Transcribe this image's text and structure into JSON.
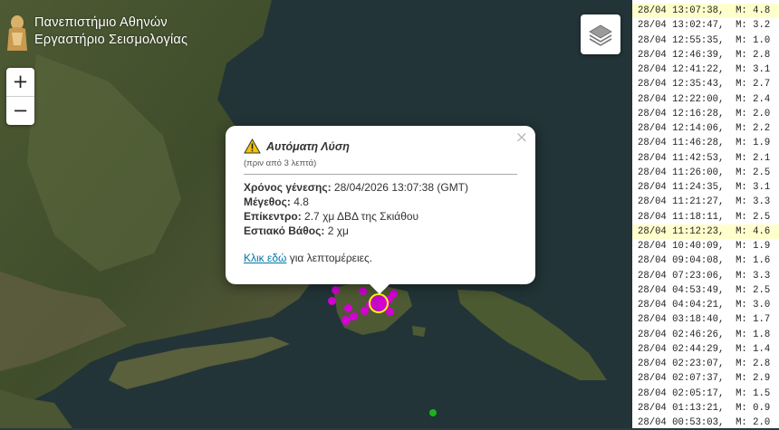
{
  "logo": {
    "line1": "Πανεπιστήμιο Αθηνών",
    "line2": "Εργαστήριο Σεισμολογίας"
  },
  "zoom": {
    "in": "+",
    "out": "−"
  },
  "layers_icon": "layers-icon",
  "popup": {
    "title": "Αυτόματη Λύση",
    "subtitle": "(πριν από 3 λεπτά)",
    "origin_label": "Χρόνος γένεσης:",
    "origin_value": "28/04/2026 13:07:38 (GMT)",
    "magnitude_label": "Μέγεθος:",
    "magnitude_value": "4.8",
    "epicenter_label": "Επίκεντρο:",
    "epicenter_value": "2.7 χμ ΔΒΔ της Σκιάθου",
    "depth_label": "Εστιακό Βάθος:",
    "depth_value": "2 χμ",
    "link_text": "Κλικ εδώ",
    "link_suffix": "για λεπτομέρειες.",
    "close": "×"
  },
  "colors": {
    "quake_marker": "#d400d4",
    "highlight": "#ffffcc",
    "link": "#0078a8"
  },
  "quakes": [
    {
      "text": "28/04 13:07:38,  M: 4.8",
      "highlight": true
    },
    {
      "text": "28/04 13:02:47,  M: 3.2",
      "highlight": false
    },
    {
      "text": "28/04 12:55:35,  M: 1.0",
      "highlight": false
    },
    {
      "text": "28/04 12:46:39,  M: 2.8",
      "highlight": false
    },
    {
      "text": "28/04 12:41:22,  M: 3.1",
      "highlight": false
    },
    {
      "text": "28/04 12:35:43,  M: 2.7",
      "highlight": false
    },
    {
      "text": "28/04 12:22:00,  M: 2.4",
      "highlight": false
    },
    {
      "text": "28/04 12:16:28,  M: 2.0",
      "highlight": false
    },
    {
      "text": "28/04 12:14:06,  M: 2.2",
      "highlight": false
    },
    {
      "text": "28/04 11:46:28,  M: 1.9",
      "highlight": false
    },
    {
      "text": "28/04 11:42:53,  M: 2.1",
      "highlight": false
    },
    {
      "text": "28/04 11:26:00,  M: 2.5",
      "highlight": false
    },
    {
      "text": "28/04 11:24:35,  M: 3.1",
      "highlight": false
    },
    {
      "text": "28/04 11:21:27,  M: 3.3",
      "highlight": false
    },
    {
      "text": "28/04 11:18:11,  M: 2.5",
      "highlight": false
    },
    {
      "text": "28/04 11:12:23,  M: 4.6",
      "highlight": true
    },
    {
      "text": "28/04 10:40:09,  M: 1.9",
      "highlight": false
    },
    {
      "text": "28/04 09:04:08,  M: 1.6",
      "highlight": false
    },
    {
      "text": "28/04 07:23:06,  M: 3.3",
      "highlight": false
    },
    {
      "text": "28/04 04:53:49,  M: 2.5",
      "highlight": false
    },
    {
      "text": "28/04 04:04:21,  M: 3.0",
      "highlight": false
    },
    {
      "text": "28/04 03:18:40,  M: 1.7",
      "highlight": false
    },
    {
      "text": "28/04 02:46:26,  M: 1.8",
      "highlight": false
    },
    {
      "text": "28/04 02:44:29,  M: 1.4",
      "highlight": false
    },
    {
      "text": "28/04 02:23:07,  M: 2.8",
      "highlight": false
    },
    {
      "text": "28/04 02:07:37,  M: 2.9",
      "highlight": false
    },
    {
      "text": "28/04 02:05:17,  M: 1.5",
      "highlight": false
    },
    {
      "text": "28/04 01:13:21,  M: 0.9",
      "highlight": false
    },
    {
      "text": "28/04 00:53:03,  M: 2.0",
      "highlight": false
    }
  ]
}
